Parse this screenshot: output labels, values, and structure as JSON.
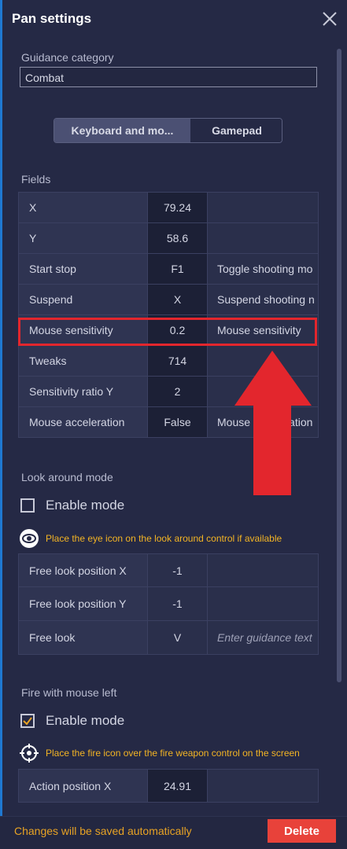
{
  "dialog": {
    "title": "Pan settings"
  },
  "guidance": {
    "label": "Guidance category",
    "value": "Combat"
  },
  "tabs": [
    {
      "label": "Keyboard and mo..."
    },
    {
      "label": "Gamepad"
    }
  ],
  "fields": {
    "label": "Fields",
    "rows": [
      {
        "name": "X",
        "value": "79.24",
        "desc": ""
      },
      {
        "name": "Y",
        "value": "58.6",
        "desc": ""
      },
      {
        "name": "Start stop",
        "value": "F1",
        "desc": "Toggle shooting mo"
      },
      {
        "name": "Suspend",
        "value": "X",
        "desc": "Suspend shooting n"
      },
      {
        "name": "Mouse sensitivity",
        "value": "0.2",
        "desc": "Mouse sensitivity"
      },
      {
        "name": "Tweaks",
        "value": "714",
        "desc": ""
      },
      {
        "name": "Sensitivity ratio Y",
        "value": "2",
        "desc": ""
      },
      {
        "name": "Mouse acceleration",
        "value": "False",
        "desc": "Mouse acceleration"
      }
    ]
  },
  "look_around": {
    "label": "Look around mode",
    "enable_label": "Enable mode",
    "enabled": false,
    "hint": "Place the eye icon on the look around control if available",
    "rows": [
      {
        "name": "Free look position X",
        "value": "-1",
        "desc": ""
      },
      {
        "name": "Free look position Y",
        "value": "-1",
        "desc": ""
      },
      {
        "name": "Free look",
        "value": "V",
        "desc": "Enter guidance text"
      }
    ]
  },
  "fire": {
    "label": "Fire with mouse left",
    "enable_label": "Enable mode",
    "enabled": true,
    "hint": "Place the fire icon over the fire weapon control on the screen",
    "rows": [
      {
        "name": "Action position X",
        "value": "24.91",
        "desc": ""
      }
    ]
  },
  "footer": {
    "note": "Changes will be saved automatically",
    "delete_label": "Delete"
  },
  "colors": {
    "accent": "#e8423a",
    "highlight": "#e3262d",
    "warning_text": "#f3b424"
  }
}
